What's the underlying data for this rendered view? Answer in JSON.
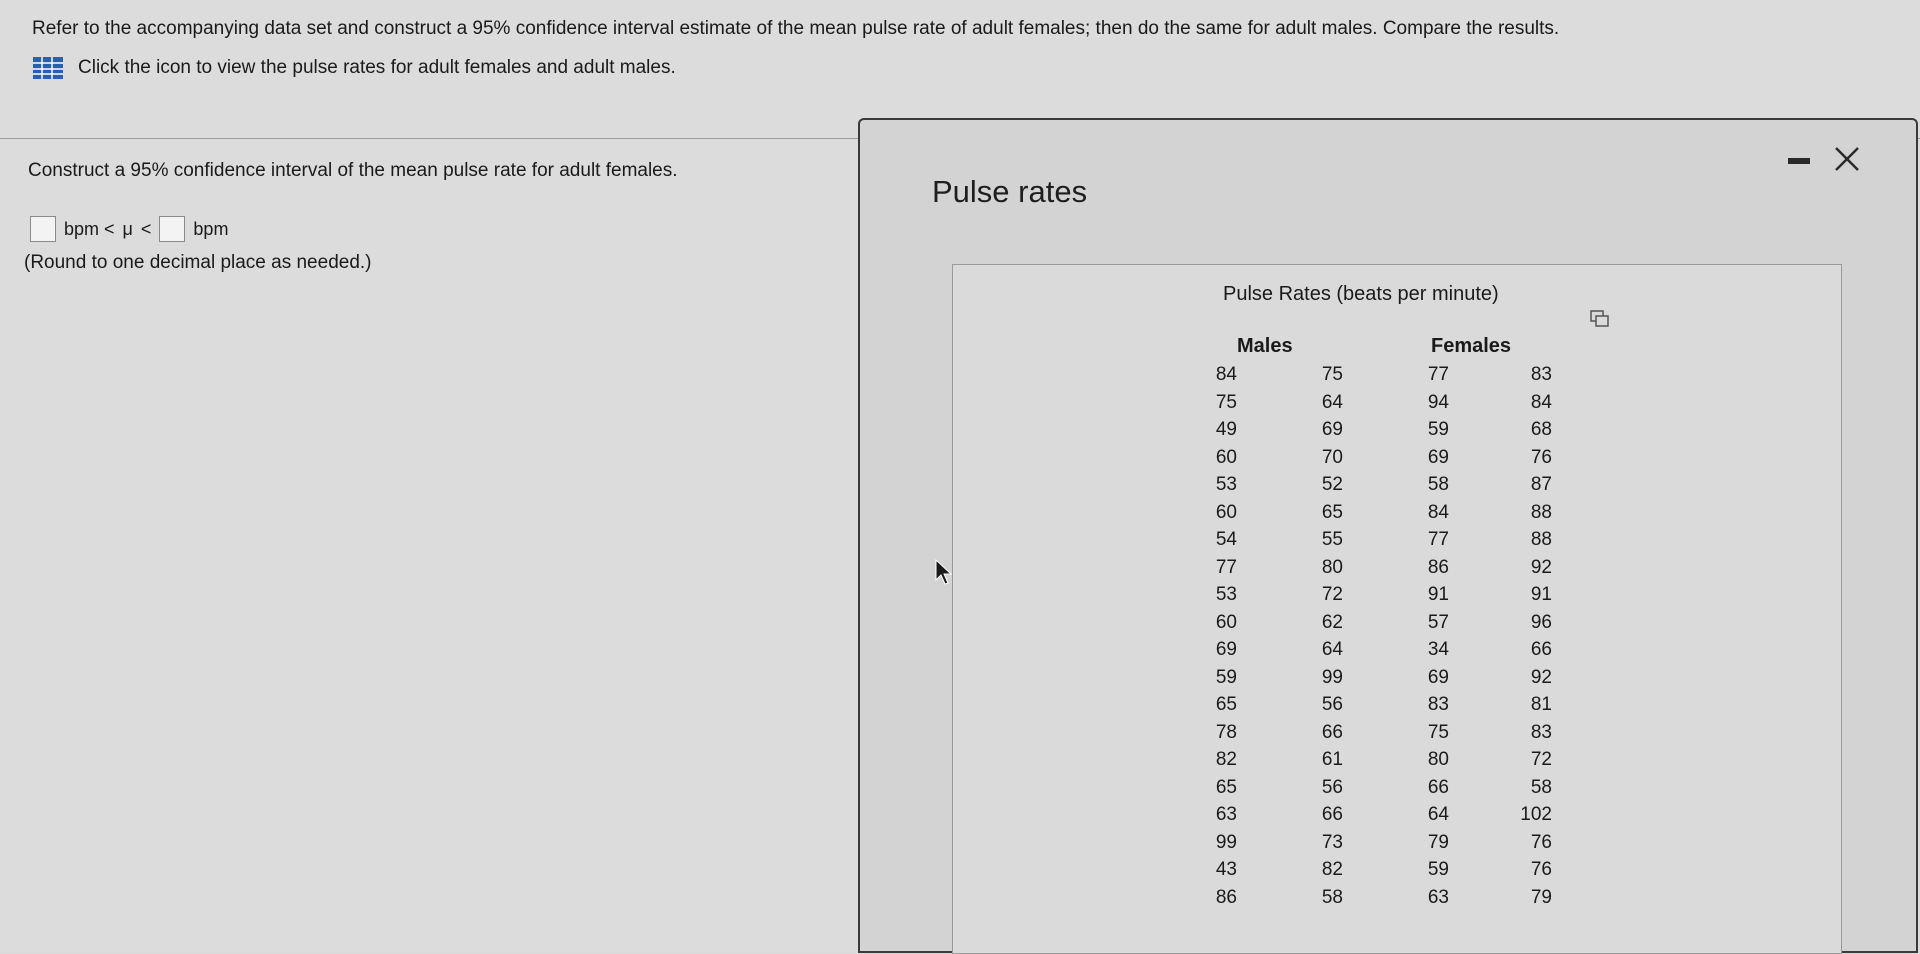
{
  "question": {
    "text": "Refer to the accompanying data set and construct a 95% confidence interval estimate of the mean pulse rate of adult females; then do the same for adult males. Compare the results.",
    "hint": "Click the icon to view the pulse rates for adult females and adult males."
  },
  "part": {
    "prompt": "Construct a 95% confidence interval of the mean pulse rate for adult females.",
    "unit_left": "bpm <",
    "mu": "μ",
    "unit_mid": "<",
    "unit_right": "bpm",
    "round_note": "(Round to one decimal place as needed.)"
  },
  "popup": {
    "title": "Pulse rates",
    "caption": "Pulse Rates (beats per minute)",
    "males_header": "Males",
    "females_header": "Females",
    "columns": [
      [
        "84",
        "75",
        "49",
        "60",
        "53",
        "60",
        "54",
        "77",
        "53",
        "60",
        "69",
        "59",
        "65",
        "78",
        "82",
        "65",
        "63",
        "99",
        "43",
        "86"
      ],
      [
        "75",
        "64",
        "69",
        "70",
        "52",
        "65",
        "55",
        "80",
        "72",
        "62",
        "64",
        "99",
        "56",
        "66",
        "61",
        "56",
        "66",
        "73",
        "82",
        "58"
      ],
      [
        "77",
        "94",
        "59",
        "69",
        "58",
        "84",
        "77",
        "86",
        "91",
        "57",
        "34",
        "69",
        "83",
        "75",
        "80",
        "66",
        "64",
        "79",
        "59",
        "63"
      ],
      [
        "83",
        "84",
        "68",
        "76",
        "87",
        "88",
        "88",
        "92",
        "91",
        "96",
        "66",
        "92",
        "81",
        "83",
        "72",
        "58",
        "102",
        "76",
        "76",
        "79"
      ]
    ]
  },
  "icons": {
    "data_table": "grid-icon",
    "minimize": "minimize-icon",
    "close": "close-icon",
    "copy": "copy-icon"
  },
  "colors": {
    "grid_icon": "#2a5fb5",
    "background": "#dcdcdc"
  }
}
